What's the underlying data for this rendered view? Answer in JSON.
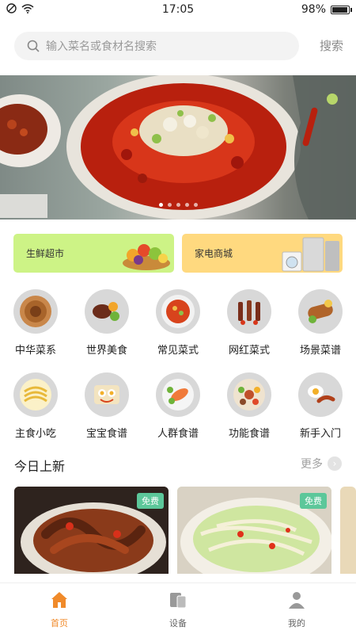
{
  "status_bar": {
    "time": "17:05",
    "battery": "98%",
    "battery_level": 0.98,
    "icons": [
      "do-not-disturb-icon",
      "wifi-icon"
    ]
  },
  "search": {
    "placeholder": "输入菜名或食材名搜索",
    "button": "搜索"
  },
  "banner": {
    "dots": 5,
    "active_dot": 0
  },
  "promos": [
    {
      "label": "生鲜超市",
      "color": "#cdf386"
    },
    {
      "label": "家电商城",
      "color": "#ffd97f"
    }
  ],
  "categories": [
    {
      "label": "中华菜系"
    },
    {
      "label": "世界美食"
    },
    {
      "label": "常见菜式"
    },
    {
      "label": "网红菜式"
    },
    {
      "label": "场景菜谱"
    },
    {
      "label": "主食小吃"
    },
    {
      "label": "宝宝食谱"
    },
    {
      "label": "人群食谱"
    },
    {
      "label": "功能食谱"
    },
    {
      "label": "新手入门"
    }
  ],
  "new_today": {
    "title": "今日上新",
    "more": "更多",
    "cards": [
      {
        "tag": "免费"
      },
      {
        "tag": "免费"
      }
    ]
  },
  "tabbar": {
    "tabs": [
      {
        "label": "首页",
        "icon": "home-icon",
        "active": true
      },
      {
        "label": "设备",
        "icon": "devices-icon",
        "active": false
      },
      {
        "label": "我的",
        "icon": "profile-icon",
        "active": false
      }
    ],
    "active_color": "#f08a2a"
  }
}
